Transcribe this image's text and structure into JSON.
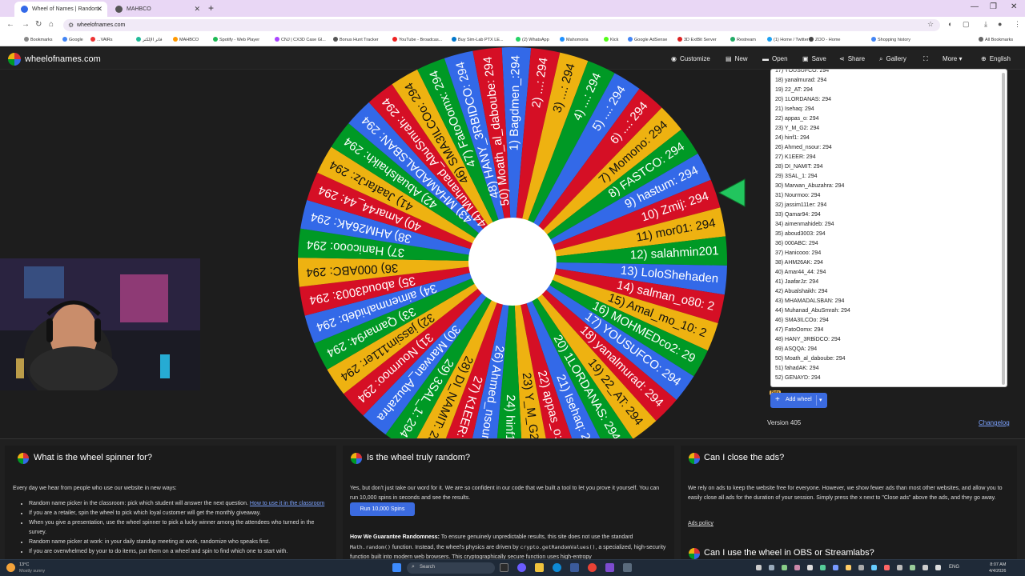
{
  "browser": {
    "tabs": [
      {
        "title": "Wheel of Names | Random",
        "active": true,
        "color": "#3369e8"
      },
      {
        "title": "MAHBCO",
        "active": false,
        "color": "#555555"
      }
    ],
    "url": "wheelofnames.com",
    "bookmarks": [
      "Bookmarks",
      "Google",
      "...VAlRs",
      "فاتر الإلكتر",
      "MAHBCO",
      "Spotify - Web Player",
      "CNJ | CX3D Case Gl...",
      "Bonus Hunt Tracker",
      "YouTube - Broadcas...",
      "Buy Sim-Lab PTX LE...",
      "(2) WhatsApp",
      "Mahomoria",
      "Kick",
      "Google AdSense",
      "3D ExtBit Server",
      "Restream",
      "(1) Home / Twitter",
      "ZOO - Home",
      "Shopping history",
      "All Bookmarks"
    ]
  },
  "site": {
    "name": "wheelofnames.com",
    "menu": [
      {
        "icon": "palette-icon",
        "label": "Customize"
      },
      {
        "icon": "file-icon",
        "label": "New"
      },
      {
        "icon": "folder-icon",
        "label": "Open"
      },
      {
        "icon": "save-icon",
        "label": "Save"
      },
      {
        "icon": "share-icon",
        "label": "Share"
      },
      {
        "icon": "search-icon",
        "label": "Gallery"
      },
      {
        "icon": "fullscreen-icon",
        "label": ""
      },
      {
        "icon": "chevron-down-icon",
        "label": "More"
      },
      {
        "icon": "globe-icon",
        "label": "English"
      }
    ]
  },
  "wheel": {
    "colors": [
      "#3369e8",
      "#d50f25",
      "#eeb211",
      "#009925"
    ],
    "segments": [
      "1) Bagdmen_:294",
      "2) ...: 294",
      "3) ...: 294",
      "4) ...: 294",
      "5) ...: 294",
      "6) ...: 294",
      "7) Momono: 294",
      "8) FASTCO: 294",
      "9) hastum: 294",
      "10) Zmij: 294",
      "11) mor01: 294",
      "12) salahmin201",
      "13) LoloShehaden",
      "14) salman_o80: 2",
      "15) Amal_mo_10: 2",
      "16) MOHMEDco2: 29",
      "17) YOUSUFCO: 294",
      "18) yanalmurad: 294",
      "19) 22_AT: 294",
      "20) 1LORDANAS: 294",
      "21) Isehaq: 294",
      "22) appas_o: 294",
      "23) Y_M_G2: 294",
      "24) hinf1: 294",
      "26) Ahmed_nsour: 294",
      "27) K1EER: 294",
      "28) DI_NAMIT: 294",
      "29) 3SAL_1: 294",
      "30) Marwan_Abuzahra",
      "31) Nourmoo: 294",
      "32) jassim111er: 294",
      "33) Qamar94: 294",
      "34) aimenmahideb: 294",
      "35) aboud3003: 294",
      "36) 000ABC: 294",
      "37) Hanicooo: 294",
      "38) AHM26AK: 294",
      "40) Amar44_44: 294",
      "41) JaafarJz: 294",
      "42) Abualshaikh: 294",
      "43) MHAMADALSBAN: 294",
      "44) Muhanad_AbuSmrah: 294",
      "46) SMA3ILCOo: 294",
      "47) FatoOomx: 294",
      "48) HANY_3RBIDCO: 294",
      "50) Moath_al_daboube: 294"
    ]
  },
  "entries": [
    "17) YOUSUFCO: 294",
    "18) yanalmurad: 294",
    "19) 22_AT: 294",
    "20) 1LORDANAS: 294",
    "21) Isehaq: 294",
    "22) appas_o: 294",
    "23) Y_M_G2: 294",
    "24) hinf1: 294",
    "26) Ahmed_nsour: 294",
    "27) K1EER: 294",
    "28) DI_NAMIT: 294",
    "29) 3SAL_1: 294",
    "30) Marwan_Abuzahra: 294",
    "31) Nourmoo: 294",
    "32) jassim111er: 294",
    "33) Qamar94: 294",
    "34) aimenmahideb: 294",
    "35) aboud3003: 294",
    "36) 000ABC: 294",
    "37) Hanicooo: 294",
    "38) AHM26AK: 294",
    "40) Amar44_44: 294",
    "41) JaafarJz: 294",
    "42) Abualshaikh: 294",
    "43) MHAMADALSBAN: 294",
    "44) Muhanad_AbuSmrah: 294",
    "46) SMA3ILCOo: 294",
    "47) FatoOomx: 294",
    "48) HANY_3RBiDCO: 294",
    "49) ASQQA: 294",
    "50) Moath_al_daboube: 294",
    "51) fahadAK: 294",
    "52) GENAYD: 294"
  ],
  "sidebar": {
    "beta": "Beta",
    "add_wheel": "Add wheel",
    "version": "Version 405",
    "changelog": "Changelog"
  },
  "cards": {
    "c1": {
      "title": "What is the wheel spinner for?",
      "intro": "Every day we hear from people who use our website in new ways:",
      "items": [
        "Random name picker in the classroom: pick which student will answer the next question.",
        "If you are a retailer, spin the wheel to pick which loyal customer will get the monthly giveaway.",
        "When you give a presentation, use the wheel spinner to pick a lucky winner among the attendees who turned in the survey.",
        "Random name picker at work: in your daily standup meeting at work, randomize who speaks first.",
        "If you are overwhelmed by your to do items, put them on a wheel and spin to find which one to start with."
      ],
      "link": "How to use it in the classroom"
    },
    "c2": {
      "title": "Is the wheel truly random?",
      "text": "Yes, but don't just take our word for it. We are so confident in our code that we built a tool to let you prove it yourself. You can run 10,000 spins in seconds and see the results.",
      "button": "Run 10,000 Spins",
      "guarantee_bold": "How We Guarantee Randomness:",
      "guarantee_1": " To ensure genuinely unpredictable results, this site does not use the standard",
      "code1": "Math.random()",
      "guarantee_2": " function. Instead, the wheel's physics are driven by ",
      "code2": "crypto.getRandomValues()",
      "guarantee_3": ", a specialized, high-security function built into modern web browsers. This cryptographically secure function uses high-entropy"
    },
    "c3": {
      "title": "Can I close the ads?",
      "text": "We rely on ads to keep the website free for everyone. However, we show fewer ads than most other websites, and allow you to easily close all ads for the duration of your session. Simply press the x next to \"Close ads\" above the ads, and they go away.",
      "link": "Ads policy",
      "title2": "Can I use the wheel in OBS or Streamlabs?"
    }
  },
  "taskbar": {
    "weather_temp": "13°C",
    "weather_desc": "Mostly sunny",
    "search": "Search",
    "lang": "ENG",
    "time": "8:07 AM",
    "date": "4/4/2026"
  }
}
